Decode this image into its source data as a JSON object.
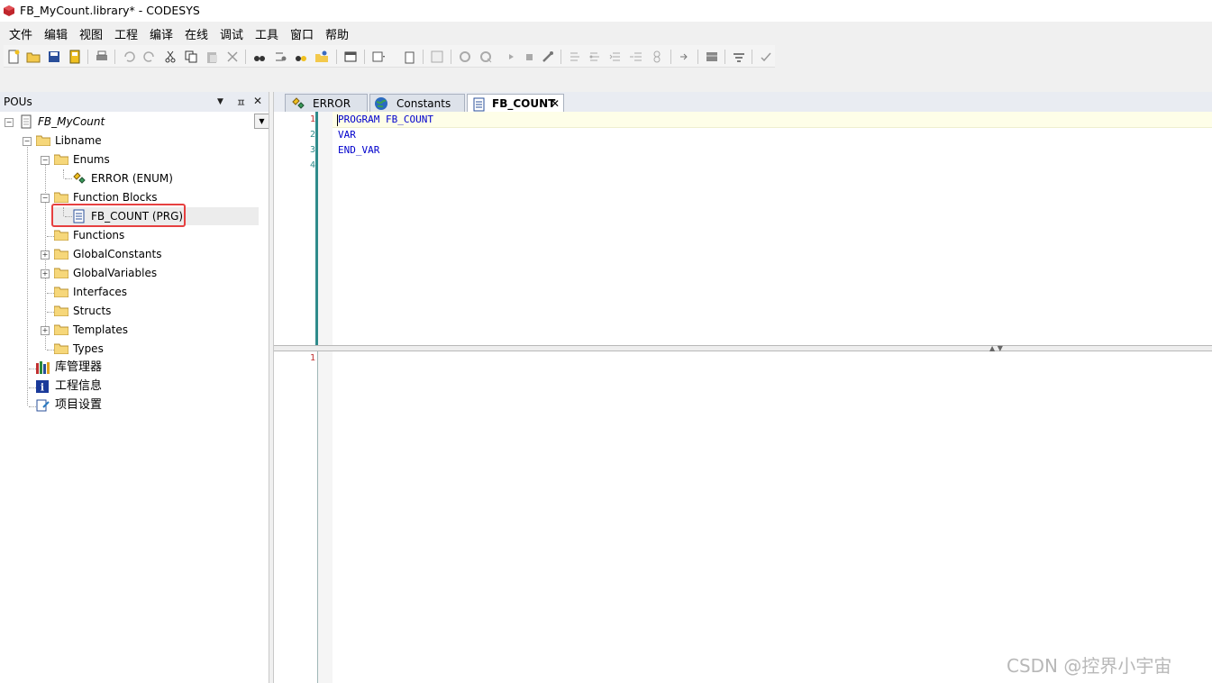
{
  "window": {
    "title": "FB_MyCount.library* - CODESYS"
  },
  "menu": [
    "文件",
    "编辑",
    "视图",
    "工程",
    "编译",
    "在线",
    "调试",
    "工具",
    "窗口",
    "帮助"
  ],
  "pou_panel": {
    "title": "POUs",
    "controls": {
      "dropdown": "▼",
      "pin": "ㅍ",
      "close": "✕"
    },
    "tree": {
      "root": "FB_MyCount",
      "libname": "Libname",
      "enums": "Enums",
      "error_enum": "ERROR (ENUM)",
      "function_blocks": "Function Blocks",
      "fb_count": "FB_COUNT (PRG)",
      "functions": "Functions",
      "global_constants": "GlobalConstants",
      "global_variables": "GlobalVariables",
      "interfaces": "Interfaces",
      "structs": "Structs",
      "templates": "Templates",
      "types": "Types",
      "library_manager": "库管理器",
      "project_info": "工程信息",
      "project_settings": "项目设置"
    }
  },
  "tabs": [
    {
      "label": "ERROR",
      "icon": "enum-icon"
    },
    {
      "label": "Constants",
      "icon": "globe-icon"
    },
    {
      "label": "FB_COUNT",
      "icon": "document-icon",
      "close": "✕"
    }
  ],
  "editor": {
    "declaration_lines": [
      "1",
      "2",
      "3",
      "4"
    ],
    "code": [
      "PROGRAM FB_COUNT",
      "VAR",
      "END_VAR"
    ],
    "implementation_lines": [
      "1"
    ]
  },
  "watermark": "CSDN @控界小宇宙",
  "colors": {
    "accent_teal": "#2e8b8b",
    "keyword_blue": "#0000cc",
    "highlight_red": "#e64040"
  }
}
